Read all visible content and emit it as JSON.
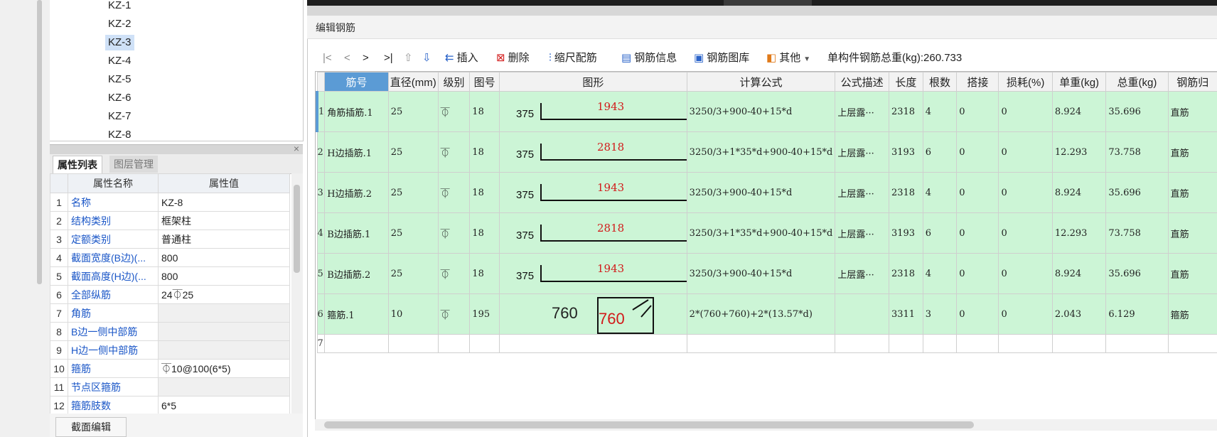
{
  "tree": {
    "items": [
      "KZ-1",
      "KZ-2",
      "KZ-3",
      "KZ-4",
      "KZ-5",
      "KZ-6",
      "KZ-7",
      "KZ-8"
    ],
    "selected": "KZ-3"
  },
  "props": {
    "tab_active": "属性列表",
    "tab_inactive": "图层管理",
    "col_name": "属性名称",
    "col_value": "属性值",
    "rows": [
      {
        "num": "1",
        "name": "名称",
        "value": "KZ-8"
      },
      {
        "num": "2",
        "name": "结构类别",
        "value": "框架柱"
      },
      {
        "num": "3",
        "name": "定额类别",
        "value": "普通柱"
      },
      {
        "num": "4",
        "name": "截面宽度(B边)(...",
        "value": "800"
      },
      {
        "num": "5",
        "name": "截面高度(H边)(...",
        "value": "800"
      },
      {
        "num": "6",
        "name": "全部纵筋",
        "value": "24⏁25"
      },
      {
        "num": "7",
        "name": "角筋",
        "value": ""
      },
      {
        "num": "8",
        "name": "B边一侧中部筋",
        "value": ""
      },
      {
        "num": "9",
        "name": "H边一侧中部筋",
        "value": ""
      },
      {
        "num": "10",
        "name": "箍筋",
        "value": "⏁10@100(6*5)"
      },
      {
        "num": "11",
        "name": "节点区箍筋",
        "value": ""
      },
      {
        "num": "12",
        "name": "箍筋肢数",
        "value": "6*5"
      }
    ],
    "close_glyph": "×",
    "section_button": "截面编辑"
  },
  "panel": {
    "title": "编辑钢筋",
    "toolbar": {
      "nav_first": "|<",
      "nav_prev": "<",
      "nav_next": ">",
      "nav_last": ">|",
      "insert": "插入",
      "delete": "删除",
      "scale": "缩尺配筋",
      "info": "钢筋信息",
      "library": "钢筋图库",
      "other": "其他",
      "total_label": "单构件钢筋总重(kg):",
      "total_value": "260.733"
    }
  },
  "grid": {
    "headers": [
      "筋号",
      "直径(mm)",
      "级别",
      "图号",
      "图形",
      "计算公式",
      "公式描述",
      "长度",
      "根数",
      "搭接",
      "损耗(%)",
      "单重(kg)",
      "总重(kg)",
      "钢筋归"
    ],
    "rows": [
      {
        "rn": "1",
        "name": "角筋插筋.1",
        "dia": "25",
        "grade": "⏁",
        "fig": "18",
        "shape_a": "375",
        "shape_b": "1943",
        "formula": "3250/3+900-40+15*d",
        "desc": "上层露···",
        "len": "2318",
        "count": "4",
        "lap": "0",
        "loss": "0",
        "unit": "8.924",
        "total": "35.696",
        "type": "直筋"
      },
      {
        "rn": "2",
        "name": "H边插筋.1",
        "dia": "25",
        "grade": "⏁",
        "fig": "18",
        "shape_a": "375",
        "shape_b": "2818",
        "formula": "3250/3+1*35*d+900-40+15*d",
        "desc": "上层露···",
        "len": "3193",
        "count": "6",
        "lap": "0",
        "loss": "0",
        "unit": "12.293",
        "total": "73.758",
        "type": "直筋"
      },
      {
        "rn": "3",
        "name": "H边插筋.2",
        "dia": "25",
        "grade": "⏁",
        "fig": "18",
        "shape_a": "375",
        "shape_b": "1943",
        "formula": "3250/3+900-40+15*d",
        "desc": "上层露···",
        "len": "2318",
        "count": "4",
        "lap": "0",
        "loss": "0",
        "unit": "8.924",
        "total": "35.696",
        "type": "直筋"
      },
      {
        "rn": "4",
        "name": "B边插筋.1",
        "dia": "25",
        "grade": "⏁",
        "fig": "18",
        "shape_a": "375",
        "shape_b": "2818",
        "formula": "3250/3+1*35*d+900-40+15*d",
        "desc": "上层露···",
        "len": "3193",
        "count": "6",
        "lap": "0",
        "loss": "0",
        "unit": "12.293",
        "total": "73.758",
        "type": "直筋"
      },
      {
        "rn": "5",
        "name": "B边插筋.2",
        "dia": "25",
        "grade": "⏁",
        "fig": "18",
        "shape_a": "375",
        "shape_b": "1943",
        "formula": "3250/3+900-40+15*d",
        "desc": "上层露···",
        "len": "2318",
        "count": "4",
        "lap": "0",
        "loss": "0",
        "unit": "8.924",
        "total": "35.696",
        "type": "直筋"
      }
    ],
    "stirrup": {
      "rn": "6",
      "name": "箍筋.1",
      "dia": "10",
      "grade": "⏁",
      "fig": "195",
      "left": "760",
      "right": "760",
      "formula": "2*(760+760)+2*(13.57*d)",
      "desc": "",
      "len": "3311",
      "count": "3",
      "lap": "0",
      "loss": "0",
      "unit": "2.043",
      "total": "6.129",
      "type": "箍筋"
    },
    "empty_rn": "7"
  }
}
